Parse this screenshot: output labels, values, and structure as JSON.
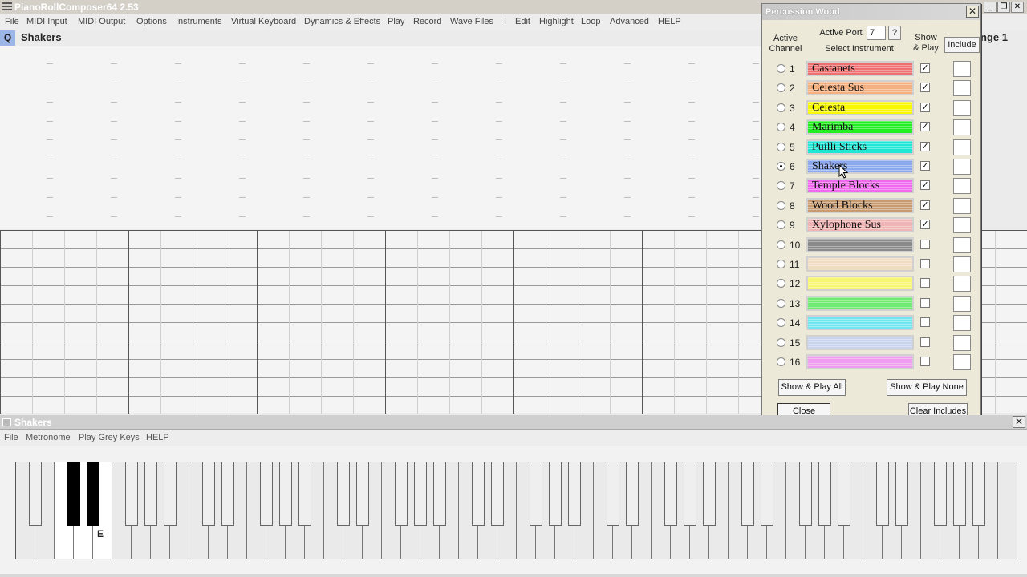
{
  "app": {
    "title": "PianoRollComposer64 2.53",
    "menu": [
      "File",
      "MIDI Input",
      "MIDI Output",
      "Options",
      "Instruments",
      "Virtual Keyboard",
      "Dynamics & Effects",
      "Play",
      "Record",
      "Wave Files",
      "I",
      "Edit",
      "Highlight",
      "Loop",
      "Advanced",
      "HELP"
    ]
  },
  "track": {
    "quick_key": "Q",
    "name": "Shakers",
    "page_label": "nge 1"
  },
  "dialog": {
    "title": "Percussion Wood",
    "active_channel_label": "Active\nChannel",
    "active_port_label": "Active Port",
    "active_port_value": "7",
    "help_label": "?",
    "select_instrument_label": "Select Instrument",
    "show_play_label": "Show\n& Play",
    "include_label": "Include",
    "channels": [
      {
        "num": "1",
        "name": "Castanets",
        "color": "#ee6f6f",
        "show": true,
        "active": false
      },
      {
        "num": "2",
        "name": "Celesta Sus",
        "color": "#f6b080",
        "show": true,
        "active": false
      },
      {
        "num": "3",
        "name": "Celesta",
        "color": "#f8f800",
        "show": true,
        "active": false
      },
      {
        "num": "4",
        "name": "Marimba",
        "color": "#22ee22",
        "show": true,
        "active": false
      },
      {
        "num": "5",
        "name": "Puilli Sticks",
        "color": "#20e6d6",
        "show": true,
        "active": false
      },
      {
        "num": "6",
        "name": "Shakers",
        "color": "#8aa8ee",
        "show": true,
        "active": true
      },
      {
        "num": "7",
        "name": "Temple Blocks",
        "color": "#f068ee",
        "show": true,
        "active": false
      },
      {
        "num": "8",
        "name": "Wood Blocks",
        "color": "#c89a70",
        "show": true,
        "active": false
      },
      {
        "num": "9",
        "name": "Xylophone Sus",
        "color": "#f0b4b4",
        "show": true,
        "active": false
      },
      {
        "num": "10",
        "name": "",
        "color": "#8a8a8a",
        "show": false,
        "active": false
      },
      {
        "num": "11",
        "name": "",
        "color": "#f0dcc0",
        "show": false,
        "active": false
      },
      {
        "num": "12",
        "name": "",
        "color": "#f6f670",
        "show": false,
        "active": false
      },
      {
        "num": "13",
        "name": "",
        "color": "#70ea70",
        "show": false,
        "active": false
      },
      {
        "num": "14",
        "name": "",
        "color": "#70e6ee",
        "show": false,
        "active": false
      },
      {
        "num": "15",
        "name": "",
        "color": "#c8d4ee",
        "show": false,
        "active": false
      },
      {
        "num": "16",
        "name": "",
        "color": "#ee9cee",
        "show": false,
        "active": false
      }
    ],
    "buttons": {
      "show_play_all": "Show & Play All",
      "show_play_none": "Show & Play None",
      "close": "Close",
      "clear_includes": "Clear Includes"
    }
  },
  "keyboard_window": {
    "title": "Shakers",
    "menu": [
      "File",
      "Metronome",
      "Play Grey Keys",
      "HELP"
    ],
    "key_label": "E",
    "close_label": "✕"
  }
}
